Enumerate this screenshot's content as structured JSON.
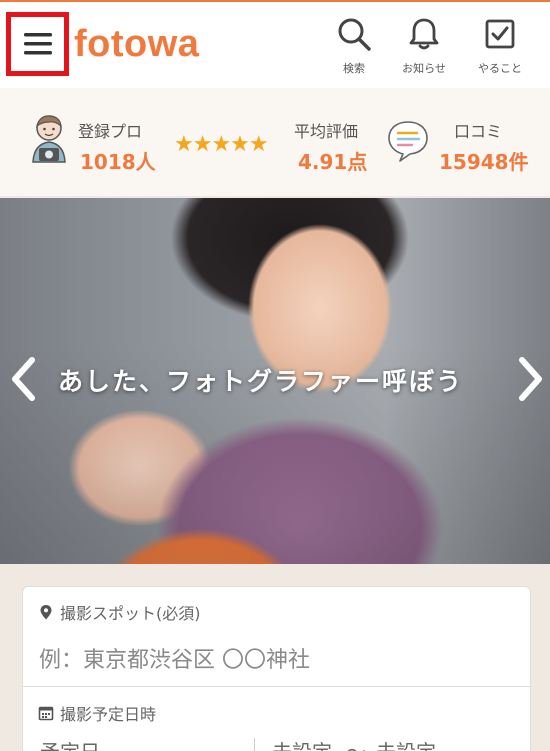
{
  "header": {
    "logo": "fotowa",
    "icons": [
      {
        "name": "search-icon",
        "label": "検索"
      },
      {
        "name": "bell-icon",
        "label": "お知らせ"
      },
      {
        "name": "checkbox-icon",
        "label": "やること"
      }
    ]
  },
  "stats": {
    "pros": {
      "label": "登録プロ",
      "value": "1018人"
    },
    "rating": {
      "label": "平均評価",
      "value": "4.91点",
      "stars": "★★★★★"
    },
    "reviews": {
      "label": "口コミ",
      "value": "15948件"
    }
  },
  "hero": {
    "headline": "あした、フォトグラファー呼ぼう"
  },
  "search": {
    "spot_label": "撮影スポット(必須)",
    "spot_placeholder": "例：東京都渋谷区 〇〇神社",
    "date_label": "撮影予定日時",
    "date_value": "予定日",
    "time_start": "未設定",
    "time_end": "未設定",
    "time_sep": "〜"
  },
  "colors": {
    "accent": "#f07a3e",
    "star": "#f7a51c",
    "highlight_border": "#e3141b"
  }
}
